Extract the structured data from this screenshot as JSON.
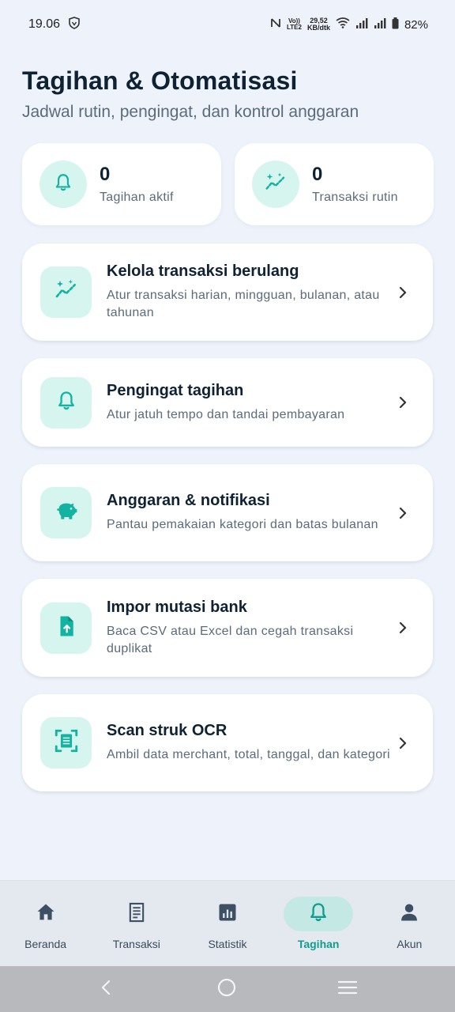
{
  "status_bar": {
    "time": "19.06",
    "net_speed_value": "29,52",
    "net_speed_unit": "KB/dtk",
    "volte_top": "Vo))",
    "volte_bottom": "LTE2",
    "battery": "82%"
  },
  "header": {
    "title": "Tagihan & Otomatisasi",
    "subtitle": "Jadwal rutin, pengingat, dan kontrol anggaran"
  },
  "stats": [
    {
      "value": "0",
      "label": "Tagihan aktif",
      "icon": "bell-icon"
    },
    {
      "value": "0",
      "label": "Transaksi rutin",
      "icon": "sparkle-trend-icon"
    }
  ],
  "menu": [
    {
      "title": "Kelola transaksi berulang",
      "description": "Atur transaksi harian, mingguan, bulanan, atau tahunan",
      "icon": "sparkle-trend-icon"
    },
    {
      "title": "Pengingat tagihan",
      "description": "Atur jatuh tempo dan tandai pembayaran",
      "icon": "bell-icon"
    },
    {
      "title": "Anggaran & notifikasi",
      "description": "Pantau pemakaian kategori dan batas bulanan",
      "icon": "piggy-bank-icon"
    },
    {
      "title": "Impor mutasi bank",
      "description": "Baca CSV atau Excel dan cegah transaksi duplikat",
      "icon": "file-upload-icon"
    },
    {
      "title": "Scan struk OCR",
      "description": "Ambil data merchant, total, tanggal, dan kategori",
      "icon": "document-scan-icon"
    }
  ],
  "bottom_nav": [
    {
      "label": "Beranda",
      "icon": "home-icon",
      "active": false
    },
    {
      "label": "Transaksi",
      "icon": "receipt-icon",
      "active": false
    },
    {
      "label": "Statistik",
      "icon": "chart-icon",
      "active": false
    },
    {
      "label": "Tagihan",
      "icon": "bell-icon",
      "active": true
    },
    {
      "label": "Akun",
      "icon": "person-icon",
      "active": false
    }
  ],
  "colors": {
    "accent": "#12b3a0",
    "accent_bg": "#d6f5ef",
    "page_bg": "#eef3fb",
    "title": "#0f2233",
    "muted": "#5b6b7b"
  }
}
